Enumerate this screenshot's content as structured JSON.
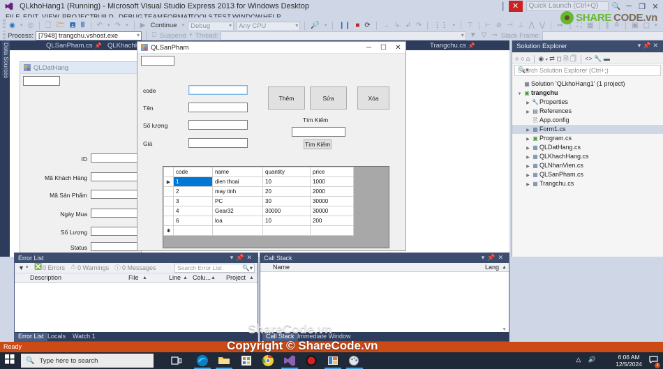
{
  "window": {
    "title": "QLkhoHang1 (Running) - Microsoft Visual Studio Express 2013 for Windows Desktop",
    "quick_launch_placeholder": "Quick Launch (Ctrl+Q)",
    "minimize": "─",
    "restore": "❐",
    "close": "✕"
  },
  "menu": [
    "FILE",
    "EDIT",
    "VIEW",
    "PROJECT",
    "BUILD",
    "DEBUG",
    "TEAM",
    "FORMAT",
    "TOOLS",
    "TEST",
    "WINDOW",
    "HELP"
  ],
  "toolbar": {
    "continue_label": "Continue",
    "config_value": "Debug",
    "platform_value": "Any CPU",
    "process_label": "Process:",
    "process_value": "[7948] trangchu.vshost.exe",
    "suspend_label": "Suspend",
    "thread_label": "Thread:",
    "thread_value": "",
    "stack_frame_label": "Stack Frame:"
  },
  "left_rail": {
    "data_sources": "Data Sources"
  },
  "doc_tabs": [
    {
      "label": "QLSanPham.cs",
      "selected": false
    },
    {
      "label": "QLKhachHang.cs",
      "selected": false
    },
    {
      "label": "Trangchu.cs",
      "selected": false
    }
  ],
  "form_background": {
    "title": "QLDatHang",
    "top_textbox_value": "",
    "fields": [
      {
        "label": "ID",
        "value": ""
      },
      {
        "label": "Mã Khách Hàng",
        "value": ""
      },
      {
        "label": "Mã Sản Phẩm",
        "value": ""
      },
      {
        "label": "Ngày Mua",
        "value": ""
      },
      {
        "label": "Số Lượng",
        "value": ""
      },
      {
        "label": "Status",
        "value": ""
      }
    ]
  },
  "form_active": {
    "title": "QLSanPham",
    "top_textbox_value": "",
    "minimize": "─",
    "maximize": "☐",
    "close": "✕",
    "fields": [
      {
        "label": "code",
        "value": "",
        "focused": true
      },
      {
        "label": "Tên",
        "value": "",
        "focused": false
      },
      {
        "label": "Số lượng",
        "value": "",
        "focused": false
      },
      {
        "label": "Giá",
        "value": "",
        "focused": false
      }
    ],
    "buttons": [
      {
        "label": "Thêm"
      },
      {
        "label": "Sửa"
      },
      {
        "label": "Xóa"
      }
    ],
    "search_label": "Tìm Kiếm",
    "search_value": "",
    "search_button": "Tìm Kiếm",
    "grid": {
      "columns": [
        "code",
        "name",
        "quantity",
        "price"
      ],
      "rows": [
        {
          "marker": "▶",
          "cells": [
            "1",
            "dien thoai",
            "10",
            "1000"
          ],
          "selected_cell": 0
        },
        {
          "marker": "",
          "cells": [
            "2",
            "may tinh",
            "20",
            "2000"
          ],
          "selected_cell": -1
        },
        {
          "marker": "",
          "cells": [
            "3",
            "PC",
            "30",
            "30000"
          ],
          "selected_cell": -1
        },
        {
          "marker": "",
          "cells": [
            "4",
            "Gear32",
            "30000",
            "30000"
          ],
          "selected_cell": -1
        },
        {
          "marker": "",
          "cells": [
            "6",
            "loa",
            "10",
            "200"
          ],
          "selected_cell": -1
        },
        {
          "marker": "✱",
          "cells": [
            "",
            "",
            "",
            ""
          ],
          "selected_cell": -1
        }
      ]
    }
  },
  "solution_explorer": {
    "title": "Solution Explorer",
    "search_placeholder": "Search Solution Explorer (Ctrl+;)",
    "tree": [
      {
        "depth": 0,
        "arrow": "",
        "icon": "solution-icon",
        "label": "Solution 'QLkhoHang1' (1 project)",
        "bold": false,
        "selected": false
      },
      {
        "depth": 1,
        "arrow": "◢",
        "icon": "csharp-project-icon",
        "label": "trangchu",
        "bold": true,
        "selected": false
      },
      {
        "depth": 2,
        "arrow": "▹",
        "icon": "properties-icon",
        "label": "Properties",
        "bold": false,
        "selected": false
      },
      {
        "depth": 2,
        "arrow": "▹",
        "icon": "references-icon",
        "label": "References",
        "bold": false,
        "selected": false
      },
      {
        "depth": 2,
        "arrow": "",
        "icon": "config-icon",
        "label": "App.config",
        "bold": false,
        "selected": false
      },
      {
        "depth": 2,
        "arrow": "▹",
        "icon": "form-icon",
        "label": "Form1.cs",
        "bold": false,
        "selected": true
      },
      {
        "depth": 2,
        "arrow": "▹",
        "icon": "csharp-file-icon",
        "label": "Program.cs",
        "bold": false,
        "selected": false
      },
      {
        "depth": 2,
        "arrow": "▹",
        "icon": "form-icon",
        "label": "QLDatHang.cs",
        "bold": false,
        "selected": false
      },
      {
        "depth": 2,
        "arrow": "▹",
        "icon": "form-icon",
        "label": "QLKhachHang.cs",
        "bold": false,
        "selected": false
      },
      {
        "depth": 2,
        "arrow": "▹",
        "icon": "form-icon",
        "label": "QLNhanVien.cs",
        "bold": false,
        "selected": false
      },
      {
        "depth": 2,
        "arrow": "▹",
        "icon": "form-icon",
        "label": "QLSanPham.cs",
        "bold": false,
        "selected": false
      },
      {
        "depth": 2,
        "arrow": "▹",
        "icon": "form-icon",
        "label": "Trangchu.cs",
        "bold": false,
        "selected": false
      }
    ]
  },
  "error_list": {
    "title": "Error List",
    "errors": "0 Errors",
    "warnings": "0 Warnings",
    "messages": "0 Messages",
    "search_placeholder": "Search Error List",
    "columns": [
      "Description",
      "File",
      "Line",
      "Colu...",
      "Project"
    ],
    "tabs": [
      {
        "label": "Error List",
        "selected": true
      },
      {
        "label": "Locals",
        "selected": false
      },
      {
        "label": "Watch 1",
        "selected": false
      }
    ]
  },
  "call_stack": {
    "title": "Call Stack",
    "columns": [
      "Name",
      "Lang"
    ],
    "tabs": [
      {
        "label": "Call Stack",
        "selected": true
      },
      {
        "label": "Immediate Window",
        "selected": false
      }
    ]
  },
  "status_bar": {
    "text": "Ready"
  },
  "taskbar": {
    "search_placeholder": "Type here to search",
    "time": "6:06 AM",
    "date": "12/5/2024",
    "notification_count": "3",
    "icons": [
      "task-view-icon",
      "edge-icon",
      "file-explorer-icon",
      "store-icon",
      "chrome-icon",
      "visual-studio-icon",
      "record-icon",
      "app-icon",
      "paint-icon"
    ]
  },
  "watermarks": {
    "middle": "ShareCode.vn",
    "copyright": "Copyright © ShareCode.vn",
    "logo_part1": "SHARE",
    "logo_part2": "CODE.vn"
  }
}
